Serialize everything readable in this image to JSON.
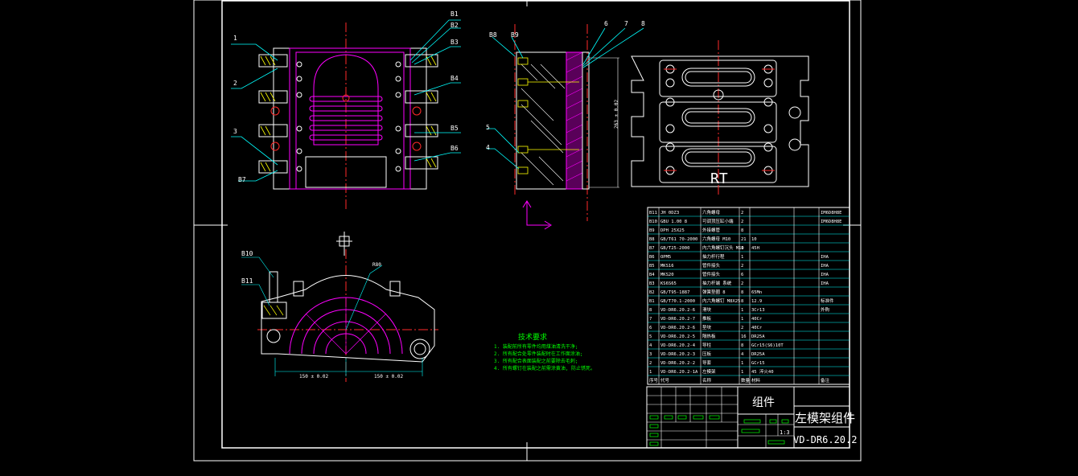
{
  "colors": {
    "background": "#000000",
    "outline": "#ffffff",
    "centerline": "#ff2a2a",
    "leader": "#00ffff",
    "part": "#ff00ff",
    "hatch": "#ffff00",
    "green": "#00ff00"
  },
  "labels": {
    "left_top": [
      "1",
      "2",
      "3",
      "B7"
    ],
    "left_right": [
      "B1",
      "B2",
      "B3",
      "B4",
      "B5",
      "B6"
    ],
    "mid_top": [
      "B8",
      "B9",
      "6",
      "7",
      "8"
    ],
    "mid_left": [
      "5",
      "4"
    ],
    "bottom_left": [
      "B10",
      "B11"
    ],
    "mid_dim": "263 ± 0.02",
    "rt": "RT",
    "dim_left": "150 ± 0.02",
    "dim_right": "150 ± 0.02",
    "arc_label": "R80"
  },
  "notes": {
    "title": "技术要求",
    "lines": [
      "1. 装配前所有零件均用煤油清洗干净;",
      "2. 所有配合处零件装配时在工作面涂油;",
      "3. 所有配合表面装配之前要除去毛刺;",
      "4. 所有螺钉在装配之前需涂黄油, 防止锈死。"
    ]
  },
  "bom": {
    "rows": [
      [
        "B11",
        "JH 0DZ3",
        "六角螺母",
        "2",
        "",
        "",
        "IM6D8H8E"
      ],
      [
        "B10",
        "GBU 1.00 8",
        "可调顶压缸小端",
        "2",
        "",
        "",
        "IM6D8H8E"
      ],
      [
        "B9",
        "DPH 25X25",
        "外接螺管",
        "8",
        "",
        "",
        ""
      ],
      [
        "B8",
        "GB/T61 70-2000",
        "六角螺母 M10",
        "21",
        "10",
        "",
        ""
      ],
      [
        "B7",
        "GB/T25-2000",
        "内六角螺钉沉头 M10",
        "1",
        "45H",
        "",
        ""
      ],
      [
        "B6",
        "OPM5",
        "抽力杆行程",
        "1",
        "",
        "",
        "IHA"
      ],
      [
        "B5",
        "MKS16",
        "管件接头",
        "2",
        "",
        "",
        "IHA"
      ],
      [
        "B4",
        "MKS20",
        "管件接头",
        "6",
        "",
        "",
        "IHA"
      ],
      [
        "B3",
        "KS6S65",
        "抽力杆端 系统",
        "2",
        "",
        "",
        "IHA"
      ],
      [
        "B2",
        "GB/T95-1887",
        "弹簧垫圈 8",
        "8",
        "65Mn",
        "",
        ""
      ],
      [
        "B1",
        "GB/T70.1-2000",
        "内六角螺钉 M8X25",
        "8",
        "12.9",
        "",
        "标准件"
      ],
      [
        "8",
        "VD-DR6.20.2-6",
        "滑块",
        "1",
        "3Cr13",
        "",
        "外购"
      ],
      [
        "7",
        "VD-DR6.20.2-7",
        "推板",
        "1",
        "40Cr",
        "",
        ""
      ],
      [
        "6",
        "VD-DR6.20.2-6",
        "垫块",
        "2",
        "40Cr",
        "",
        ""
      ],
      [
        "5",
        "VD-DR6.20.2-5",
        "隔热板",
        "16",
        "DR25A",
        "",
        ""
      ],
      [
        "4",
        "VD-DR6.20.2-4",
        "导柱",
        "8",
        "GCr15(S6)10T",
        "",
        ""
      ],
      [
        "3",
        "VD-DR6.20.2-3",
        "压板",
        "4",
        "DR25A",
        "",
        ""
      ],
      [
        "2",
        "VD-DR6.20.2-2",
        "导套",
        "1",
        "GCr15",
        "",
        ""
      ],
      [
        "1",
        "VD-DR6.20.2-1A",
        "左模架",
        "1",
        "45 淬火40",
        "",
        ""
      ]
    ],
    "header": [
      "序号",
      "代号",
      "名称",
      "数量",
      "材料",
      "",
      "备注"
    ]
  },
  "titleblock": {
    "group": "组件",
    "name": "左模架组件",
    "scale": "1:3",
    "code": "VD-DR6.20.2"
  }
}
